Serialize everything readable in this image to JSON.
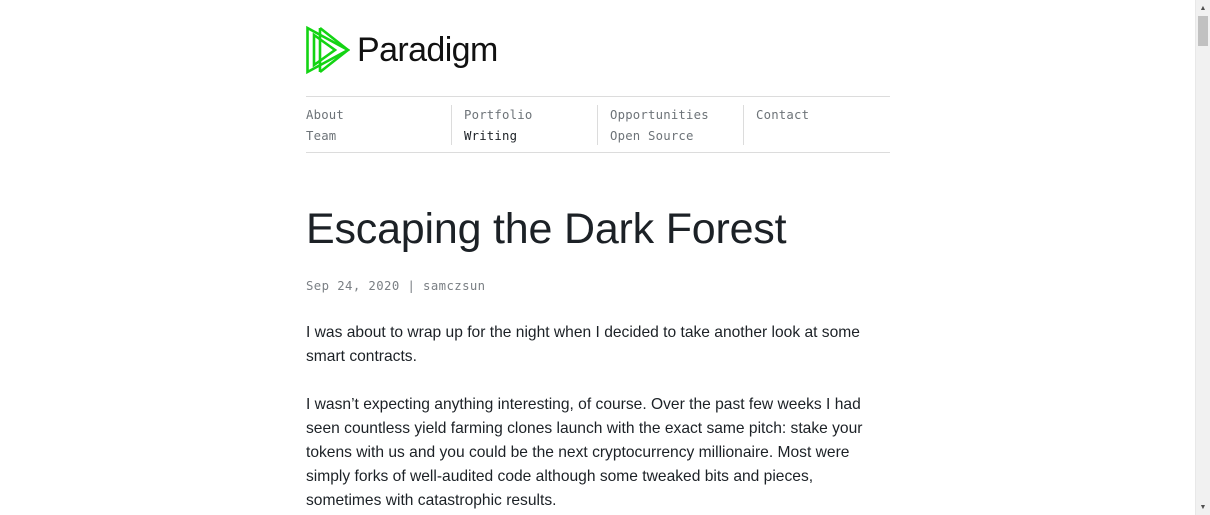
{
  "brand": {
    "name": "Paradigm",
    "accent_color": "#13d413"
  },
  "nav": {
    "columns": [
      {
        "links": [
          {
            "label": "About"
          },
          {
            "label": "Team"
          }
        ]
      },
      {
        "links": [
          {
            "label": "Portfolio"
          },
          {
            "label": "Writing",
            "active": true
          }
        ]
      },
      {
        "links": [
          {
            "label": "Opportunities"
          },
          {
            "label": "Open Source"
          }
        ]
      },
      {
        "links": [
          {
            "label": "Contact"
          }
        ]
      }
    ]
  },
  "article": {
    "title": "Escaping the Dark Forest",
    "date": "Sep 24, 2020",
    "separator": "|",
    "author": "samczsun",
    "meta_line": "Sep 24, 2020 | samczsun",
    "paragraphs": [
      "I was about to wrap up for the night when I decided to take another look at some smart contracts.",
      "I wasn’t expecting anything interesting, of course. Over the past few weeks I had seen countless yield farming clones launch with the exact same pitch: stake your tokens with us and you could be the next cryptocurrency millionaire. Most were simply forks of well-audited code although some tweaked bits and pieces, sometimes with catastrophic results."
    ]
  },
  "scrollbar": {
    "up_icon": "triangle-up",
    "down_icon": "triangle-down"
  }
}
